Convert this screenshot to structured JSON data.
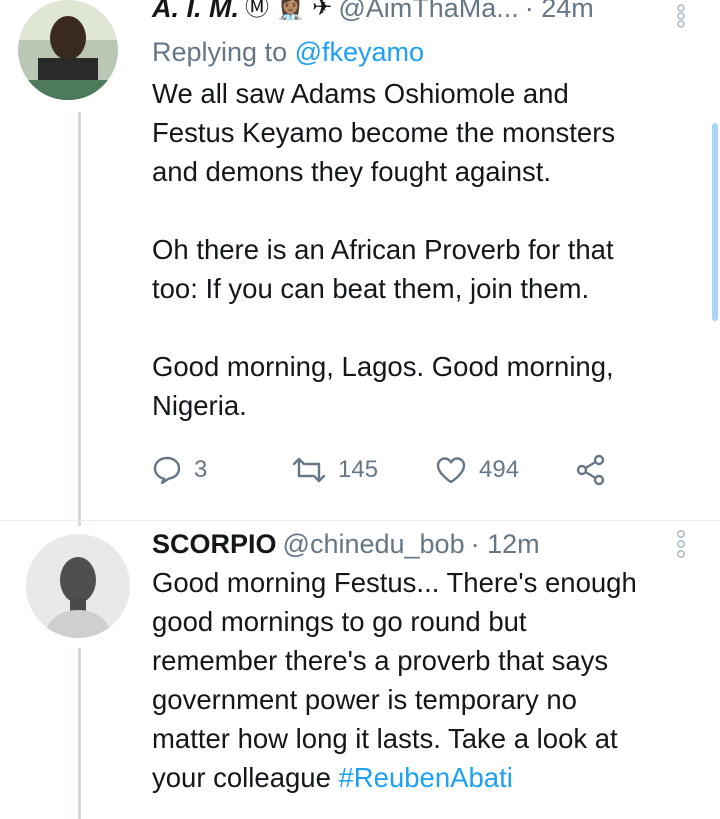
{
  "tweet1": {
    "display_name": "A. I. M.",
    "emoji_badges": "Ⓜ 👩🏽‍⚕️ ✈",
    "handle": "@AimThaMa...",
    "time": "· 24m",
    "replying_prefix": "Replying to",
    "replying_handle": "@fkeyamo",
    "lines_p1": [
      "We all saw Adams Oshiomole and",
      "Festus Keyamo become the monsters",
      "and demons they fought against."
    ],
    "lines_p2": [
      "Oh there is an African Proverb for that",
      "too: If you can beat them, join them."
    ],
    "lines_p3": [
      "Good morning, Lagos. Good morning,",
      "Nigeria."
    ],
    "reply_count": "3",
    "retweet_count": "145",
    "like_count": "494"
  },
  "tweet2": {
    "display_name": "SCORPIO",
    "handle": "@chinedu_bob",
    "time": "· 12m",
    "lines": [
      "Good morning Festus... There's enough",
      "good mornings to go round but",
      "remember there's a proverb that says",
      "government power is temporary no",
      "matter how long it lasts. Take a look at",
      "your colleague "
    ],
    "hashtag": "#ReubenAbati"
  },
  "colors": {
    "link": "#1da1f2",
    "secondary": "#657786",
    "thread_line": "#cfd9de"
  },
  "icons": [
    "more-icon",
    "reply-icon",
    "retweet-icon",
    "like-icon",
    "share-icon"
  ]
}
